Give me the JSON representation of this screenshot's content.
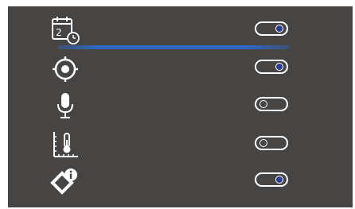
{
  "calendar": {
    "day_digits": "2",
    "icon": "calendar-clock-icon",
    "toggle_state": "on"
  },
  "progress": {
    "icon": "progress-bar",
    "color": "#2e68c4"
  },
  "location": {
    "icon": "gps-target-icon",
    "toggle_state": "on"
  },
  "microphone": {
    "icon": "microphone-icon",
    "toggle_state": "off"
  },
  "temperature": {
    "icon": "thermometer-ruler-icon",
    "toggle_state": "off"
  },
  "diagnostics": {
    "icon": "diamond-info-icon",
    "toggle_state": "on"
  },
  "colors": {
    "panel_bg": "#474444",
    "toggle_on_knob": "#2f3d8e",
    "icon_stroke": "#ffffff"
  }
}
